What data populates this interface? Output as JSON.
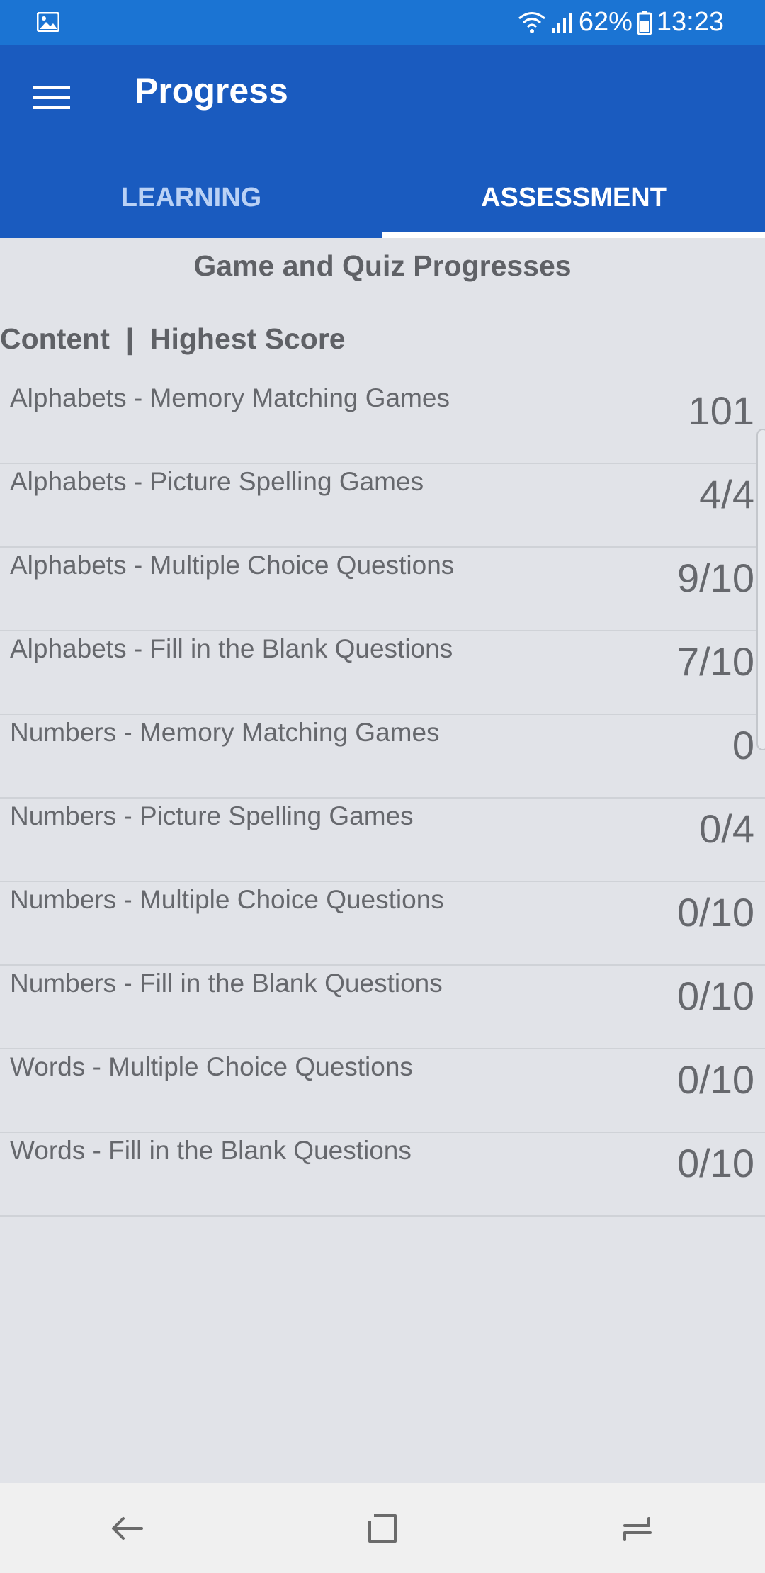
{
  "status_bar": {
    "battery": "62%",
    "time": "13:23"
  },
  "app_bar": {
    "title": "Progress"
  },
  "tabs": [
    {
      "label": "LEARNING",
      "active": false
    },
    {
      "label": "ASSESSMENT",
      "active": true
    }
  ],
  "section": {
    "title": "Game and Quiz Progresses",
    "header": "Content  |  Highest Score"
  },
  "rows": [
    {
      "label": "Alphabets - Memory Matching Games",
      "score": "101"
    },
    {
      "label": "Alphabets - Picture Spelling Games",
      "score": "4/4"
    },
    {
      "label": "Alphabets - Multiple Choice Questions",
      "score": "9/10"
    },
    {
      "label": "Alphabets - Fill in the Blank Questions",
      "score": "7/10"
    },
    {
      "label": "Numbers - Memory Matching Games",
      "score": "0"
    },
    {
      "label": "Numbers - Picture Spelling Games",
      "score": "0/4"
    },
    {
      "label": "Numbers - Multiple Choice Questions",
      "score": "0/10"
    },
    {
      "label": "Numbers - Fill in the Blank Questions",
      "score": "0/10"
    },
    {
      "label": "Words - Multiple Choice Questions",
      "score": "0/10"
    },
    {
      "label": "Words - Fill in the Blank Questions",
      "score": "0/10"
    }
  ],
  "icons": {
    "status_left": "gallery-icon",
    "status_right": [
      "wifi-icon",
      "signal-icon",
      "battery-icon"
    ],
    "app_bar": "hamburger-menu-icon",
    "nav": [
      "back-icon",
      "home-icon",
      "recents-icon"
    ]
  },
  "colors": {
    "status_bar": "#1b74d3",
    "app_bar": "#1a5bbf",
    "background": "#e1e3e8",
    "text": "#66686d"
  }
}
